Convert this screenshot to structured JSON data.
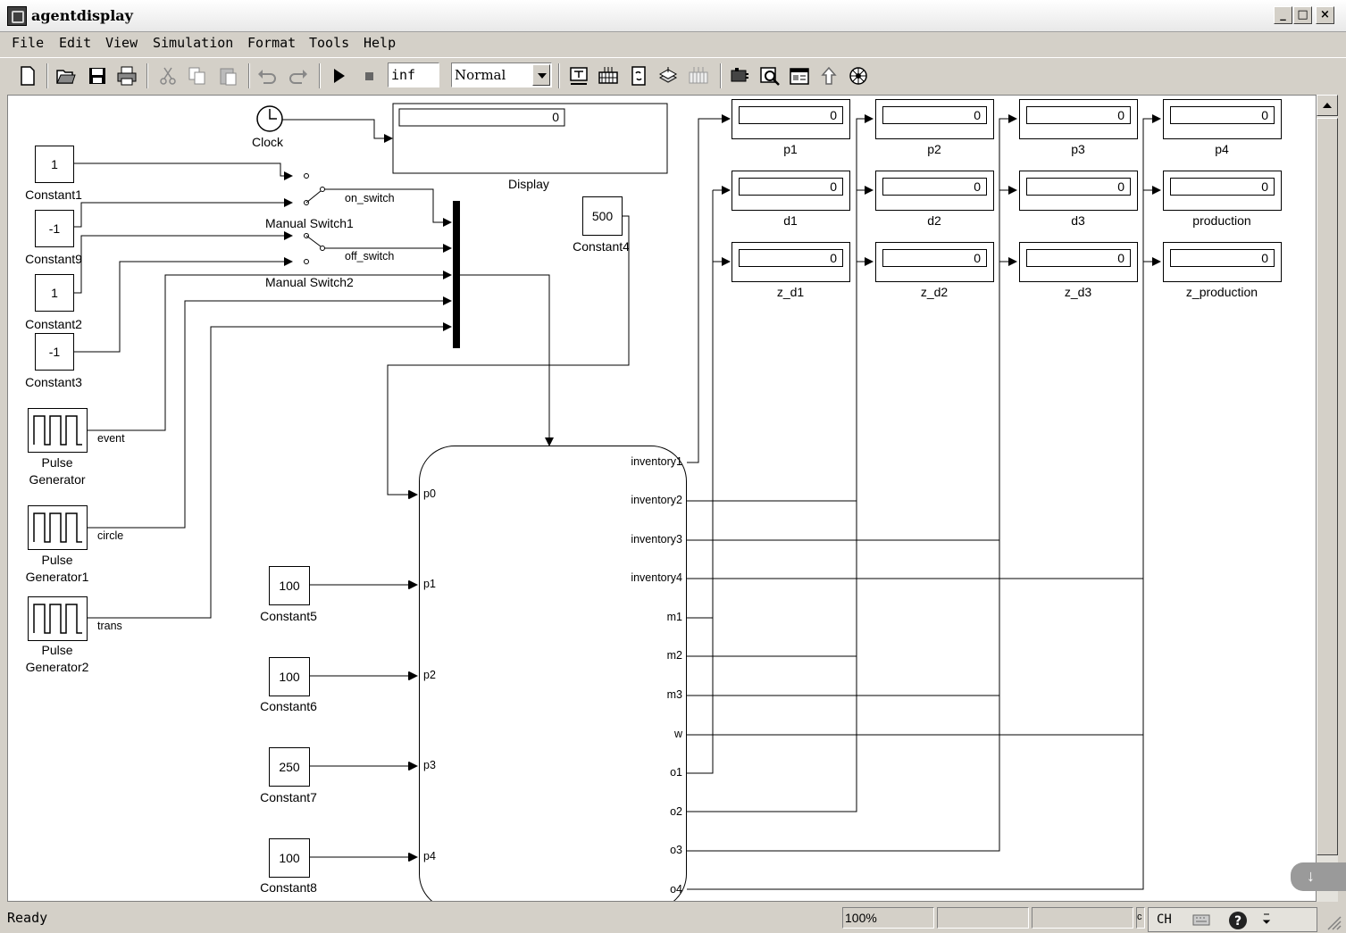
{
  "window": {
    "title": "agentdisplay"
  },
  "menu": [
    "File",
    "Edit",
    "View",
    "Simulation",
    "Format",
    "Tools",
    "Help"
  ],
  "toolbar": {
    "stop_time": "inf",
    "sim_mode": "Normal"
  },
  "status": {
    "text": "Ready",
    "zoom": "100%",
    "lang": "CH",
    "extra": "c"
  },
  "blocks": {
    "clock": "Clock",
    "display": {
      "label": "Display",
      "value": "0"
    },
    "constants": [
      {
        "label": "Constant1",
        "value": "1"
      },
      {
        "label": "Constant9",
        "value": "-1"
      },
      {
        "label": "Constant2",
        "value": "1"
      },
      {
        "label": "Constant3",
        "value": "-1"
      },
      {
        "label": "Constant4",
        "value": "500"
      },
      {
        "label": "Constant5",
        "value": "100"
      },
      {
        "label": "Constant6",
        "value": "100"
      },
      {
        "label": "Constant7",
        "value": "250"
      },
      {
        "label": "Constant8",
        "value": "100"
      }
    ],
    "switches": [
      {
        "label": "Manual Switch1",
        "signal": "on_switch"
      },
      {
        "label": "Manual Switch2",
        "signal": "off_switch"
      }
    ],
    "pulses": [
      {
        "line1": "Pulse",
        "line2": "Generator",
        "signal": "event"
      },
      {
        "line1": "Pulse",
        "line2": "Generator1",
        "signal": "circle"
      },
      {
        "line1": "Pulse",
        "line2": "Generator2",
        "signal": "trans"
      }
    ],
    "chart_inputs": [
      "p0",
      "p1",
      "p2",
      "p3",
      "p4"
    ],
    "chart_outputs": [
      "inventory1",
      "inventory2",
      "inventory3",
      "inventory4",
      "m1",
      "m2",
      "m3",
      "w",
      "o1",
      "o2",
      "o3",
      "o4"
    ],
    "displays": [
      {
        "label": "p1",
        "value": "0"
      },
      {
        "label": "p2",
        "value": "0"
      },
      {
        "label": "p3",
        "value": "0"
      },
      {
        "label": "p4",
        "value": "0"
      },
      {
        "label": "d1",
        "value": "0"
      },
      {
        "label": "d2",
        "value": "0"
      },
      {
        "label": "d3",
        "value": "0"
      },
      {
        "label": "production",
        "value": "0"
      },
      {
        "label": "z_d1",
        "value": "0"
      },
      {
        "label": "z_d2",
        "value": "0"
      },
      {
        "label": "z_d3",
        "value": "0"
      },
      {
        "label": "z_production",
        "value": "0"
      }
    ]
  }
}
